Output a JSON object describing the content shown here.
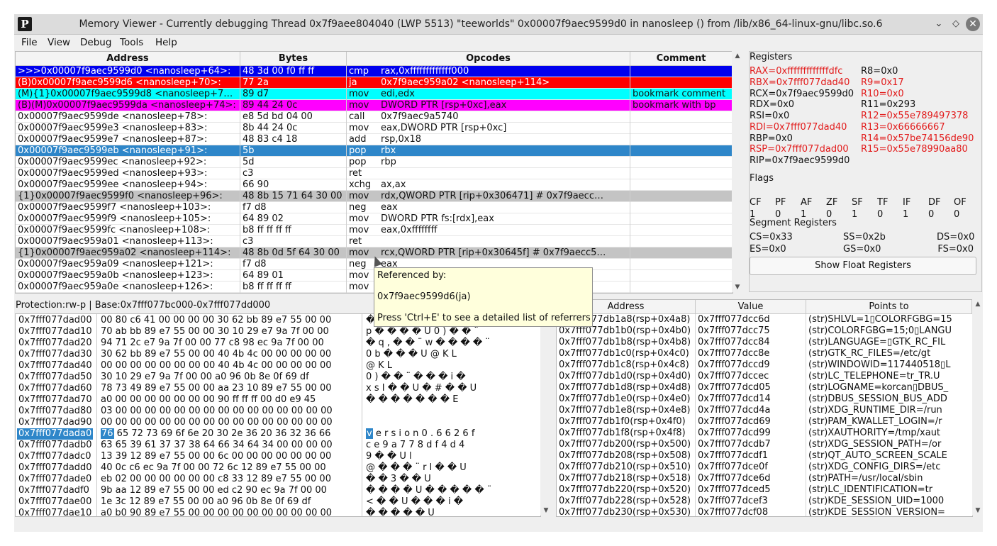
{
  "window": {
    "title": "Memory Viewer - Currently debugging Thread 0x7f9aee804040 (LWP 5513) \"teeworlds\" 0x00007f9aec9599d0 in nanosleep () from /lib/x86_64-linux-gnu/libc.so.6",
    "app_icon": "P",
    "controls": [
      "chevron-down-icon",
      "diamond-icon",
      "close-icon"
    ]
  },
  "menu": [
    {
      "label": "File"
    },
    {
      "label": "View"
    },
    {
      "label": "Debug"
    },
    {
      "label": "Tools"
    },
    {
      "label": "Help"
    }
  ],
  "disasm": {
    "headers": [
      "Address",
      "Bytes",
      "Opcodes",
      "Comment"
    ],
    "rows": [
      {
        "addr": ">>>0x00007f9aec9599d0 <nanosleep+64>:",
        "bytes": "48 3d 00 f0 ff ff",
        "op": "cmp",
        "args": "rax,0xfffffffffffff000",
        "comment": "",
        "bg": "#0000ee",
        "fg": "#ffffff"
      },
      {
        "addr": "(B)0x00007f9aec9599d6 <nanosleep+70>:",
        "bytes": "77 2a",
        "op": "ja",
        "args": "0x7f9aec959a02 <nanosleep+114>",
        "comment": "",
        "bg": "#ff0000",
        "fg": "#ffffff"
      },
      {
        "addr": "(M){1}0x00007f9aec9599d8 <nanosleep+7…",
        "bytes": "89 d7",
        "op": "mov",
        "args": "edi,edx",
        "comment": "bookmark comment",
        "bg": "#00ffff",
        "fg": "#111111"
      },
      {
        "addr": "(B)(M)0x00007f9aec9599da <nanosleep+74>:",
        "bytes": "89 44 24 0c",
        "op": "mov",
        "args": "DWORD PTR [rsp+0xc],eax",
        "comment": "bookmark with bp",
        "bg": "#ff00ff",
        "fg": "#111111"
      },
      {
        "addr": "0x00007f9aec9599de <nanosleep+78>:",
        "bytes": "e8 5d bd 04 00",
        "op": "call",
        "args": "0x7f9aec9a5740",
        "comment": "",
        "bg": "#ffffff",
        "fg": "#111111"
      },
      {
        "addr": "0x00007f9aec9599e3 <nanosleep+83>:",
        "bytes": "8b 44 24 0c",
        "op": "mov",
        "args": "eax,DWORD PTR [rsp+0xc]",
        "comment": "",
        "bg": "#ffffff",
        "fg": "#111111"
      },
      {
        "addr": "0x00007f9aec9599e7 <nanosleep+87>:",
        "bytes": "48 83 c4 18",
        "op": "add",
        "args": "rsp,0x18",
        "comment": "",
        "bg": "#ffffff",
        "fg": "#111111"
      },
      {
        "addr": "0x00007f9aec9599eb <nanosleep+91>:",
        "bytes": "5b",
        "op": "pop",
        "args": "rbx",
        "comment": "",
        "bg": "#2e86c9",
        "fg": "#ffffff"
      },
      {
        "addr": "0x00007f9aec9599ec <nanosleep+92>:",
        "bytes": "5d",
        "op": "pop",
        "args": "rbp",
        "comment": "",
        "bg": "#ffffff",
        "fg": "#111111"
      },
      {
        "addr": "0x00007f9aec9599ed <nanosleep+93>:",
        "bytes": "c3",
        "op": "ret",
        "args": "",
        "comment": "",
        "bg": "#ffffff",
        "fg": "#111111"
      },
      {
        "addr": "0x00007f9aec9599ee <nanosleep+94>:",
        "bytes": "66 90",
        "op": "xchg",
        "args": "ax,ax",
        "comment": "",
        "bg": "#ffffff",
        "fg": "#111111"
      },
      {
        "addr": "{1}0x00007f9aec9599f0 <nanosleep+96>:",
        "bytes": "48 8b 15 71 64 30 00",
        "op": "mov",
        "args": "rdx,QWORD PTR [rip+0x306471]        # 0x7f9aecc…",
        "comment": "",
        "bg": "#c4c4c4",
        "fg": "#111111"
      },
      {
        "addr": "0x00007f9aec9599f7 <nanosleep+103>:",
        "bytes": "f7 d8",
        "op": "neg",
        "args": "eax",
        "comment": "",
        "bg": "#ffffff",
        "fg": "#111111"
      },
      {
        "addr": "0x00007f9aec9599f9 <nanosleep+105>:",
        "bytes": "64 89 02",
        "op": "mov",
        "args": "DWORD PTR fs:[rdx],eax",
        "comment": "",
        "bg": "#ffffff",
        "fg": "#111111"
      },
      {
        "addr": "0x00007f9aec9599fc <nanosleep+108>:",
        "bytes": "b8 ff ff ff ff",
        "op": "mov",
        "args": "eax,0xffffffff",
        "comment": "",
        "bg": "#ffffff",
        "fg": "#111111"
      },
      {
        "addr": "0x00007f9aec959a01 <nanosleep+113>:",
        "bytes": "c3",
        "op": "ret",
        "args": "",
        "comment": "",
        "bg": "#ffffff",
        "fg": "#111111"
      },
      {
        "addr": "{1}0x00007f9aec959a02 <nanosleep+114>:",
        "bytes": "48 8b 0d 5f 64 30 00",
        "op": "mov",
        "args": "rcx,QWORD PTR [rip+0x30645f]        # 0x7f9aecc5…",
        "comment": "",
        "bg": "#c4c4c4",
        "fg": "#111111"
      },
      {
        "addr": "0x00007f9aec959a09 <nanosleep+121>:",
        "bytes": "f7 d8",
        "op": "neg",
        "args": "eax",
        "comment": "",
        "bg": "#ffffff",
        "fg": "#111111"
      },
      {
        "addr": "0x00007f9aec959a0b <nanosleep+123>:",
        "bytes": "64 89 01",
        "op": "mov",
        "args": "",
        "comment": "",
        "bg": "#ffffff",
        "fg": "#111111"
      },
      {
        "addr": "0x00007f9aec959a0e <nanosleep+126>:",
        "bytes": "b8 ff ff ff ff",
        "op": "mov",
        "args": "",
        "comment": "",
        "bg": "#ffffff",
        "fg": "#111111"
      }
    ]
  },
  "registers": {
    "title": "Registers",
    "left": [
      {
        "text": "RAX=0xfffffffffffffdfc",
        "changed": true
      },
      {
        "text": "RBX=0x7fff077dad40",
        "changed": true
      },
      {
        "text": "RCX=0x7f9aec9599d0",
        "changed": false
      },
      {
        "text": "RDX=0x0",
        "changed": false
      },
      {
        "text": "RSI=0x0",
        "changed": false
      },
      {
        "text": "RDI=0x7fff077dad40",
        "changed": true
      },
      {
        "text": "RBP=0x0",
        "changed": false
      },
      {
        "text": "RSP=0x7fff077dad00",
        "changed": true
      },
      {
        "text": "RIP=0x7f9aec9599d0",
        "changed": false
      }
    ],
    "right": [
      {
        "text": "R8=0x0",
        "changed": false
      },
      {
        "text": "R9=0x17",
        "changed": true
      },
      {
        "text": "R10=0x0",
        "changed": true
      },
      {
        "text": "R11=0x293",
        "changed": false
      },
      {
        "text": "R12=0x55e789497378",
        "changed": true
      },
      {
        "text": "R13=0x66666667",
        "changed": true
      },
      {
        "text": "R14=0x57be74156de90",
        "changed": true
      },
      {
        "text": "R15=0x55e78990aa80",
        "changed": true
      }
    ],
    "flags_title": "Flags",
    "flags": [
      {
        "name": "CF",
        "value": "1"
      },
      {
        "name": "PF",
        "value": "0"
      },
      {
        "name": "AF",
        "value": "1"
      },
      {
        "name": "ZF",
        "value": "0"
      },
      {
        "name": "SF",
        "value": "1"
      },
      {
        "name": "TF",
        "value": "0"
      },
      {
        "name": "IF",
        "value": "1"
      },
      {
        "name": "DF",
        "value": "0"
      },
      {
        "name": "OF",
        "value": "0"
      }
    ],
    "segment_title": "Segment Registers",
    "segments": [
      "CS=0x33",
      "SS=0x2b",
      "DS=0x0",
      "ES=0x0",
      "GS=0x0",
      "FS=0x0"
    ],
    "show_float": "Show Float Registers"
  },
  "hex": {
    "info": "Protection:rw-p | Base:0x7fff077bc000-0x7fff077dd000",
    "rows": [
      {
        "addr": "0x7fff077dad00",
        "bytes": "00 80 c6 41 00 00 00 00 30 62 bb 89 e7 55 00 00",
        "ascii": "� � A         0 b � � � U    "
      },
      {
        "addr": "0x7fff077dad10",
        "bytes": "70 ab bb 89 e7 55 00 00 30 10 29 e7 9a 7f 00 00",
        "ascii": "p � � � � U     0 ) � � ¨  "
      },
      {
        "addr": "0x7fff077dad20",
        "bytes": "94 71 2c e7 9a 7f 00 00 77 c8 98 ec 9a 7f 00 00",
        "ascii": "� q , � � ¨     w � � � � ¨  "
      },
      {
        "addr": "0x7fff077dad30",
        "bytes": "30 62 bb 89 e7 55 00 00 40 4b 4c 00 00 00 00 00",
        "ascii": "0 b � � � U     @ K L        "
      },
      {
        "addr": "0x7fff077dad40",
        "bytes": "00 00 00 00 00 00 00 00 40 4b 4c 00 00 00 00 00",
        "ascii": "                @ K L        "
      },
      {
        "addr": "0x7fff077dad50",
        "bytes": "30 10 29 e7 9a 7f 00 00 a0 96 0b 8e 0f 69 df",
        "ascii": "0   ) � � ¨     � � � i �"
      },
      {
        "addr": "0x7fff077dad60",
        "bytes": "78 73 49 89 e7 55 00 00 aa 23 10 89 e7 55 00 00",
        "ascii": "x s I � � U     � # � � U    "
      },
      {
        "addr": "0x7fff077dad70",
        "bytes": "a0 00 00 00 00 00 00 00 90 ff ff ff 00 d0 e9 45",
        "ascii": "�               � � � �   � � E"
      },
      {
        "addr": "0x7fff077dad80",
        "bytes": "03 00 00 00 00 00 00 00 00 00 00 00 00 00 00 00",
        "ascii": "                             "
      },
      {
        "addr": "0x7fff077dad90",
        "bytes": "00 00 00 00 00 00 00 00 00 00 00 00 00 00 00 00",
        "ascii": "                             "
      },
      {
        "addr": "0x7fff077dada0",
        "bytes": "76 65 72 73 69 6f 6e 20 30 2e 36 20 36 32 36 66",
        "ascii": "v e r s i o n   0 . 6   6 2 6 f"
      },
      {
        "addr": "0x7fff077dadb0",
        "bytes": "63 65 39 61 37 37 38 64 66 34 64 34 00 00 00 00",
        "ascii": "c e 9 a 7 7 8 d f 4 d 4      "
      },
      {
        "addr": "0x7fff077dadc0",
        "bytes": "13 39 12 89 e7 55 00 00 6c 00 00 00 00 00 00 00",
        "ascii": "  9   � � U     l            "
      },
      {
        "addr": "0x7fff077dadd0",
        "bytes": "40 0c c6 ec 9a 7f 00 00 72 6c 12 89 e7 55 00 00",
        "ascii": "@   � � � ¨     r l   � � U    "
      },
      {
        "addr": "0x7fff077dade0",
        "bytes": "eb 02 00 00 00 00 00 00 c8 33 12 89 e7 55 00 00",
        "ascii": "�               � 3   � � U    "
      },
      {
        "addr": "0x7fff077dadf0",
        "bytes": "9b aa 12 89 e7 55 00 00 ed c2 90 ec 9a 7f 00 00",
        "ascii": "� �   � � U     � � � � � ¨  "
      },
      {
        "addr": "0x7fff077dae00",
        "bytes": "1e 3c 12 89 e7 55 00 00 a0 96 0b 8e 0f 69 df",
        "ascii": "  <   � � U     � � � i �"
      },
      {
        "addr": "0x7fff077dae10",
        "bytes": "a0 b0 90 89 e7 55 00 00 00 00 00 00 00 00 00 00",
        "ascii": "� � � � � U                  "
      }
    ],
    "selected_addr": "0x7fff077dada0",
    "selected_byte": "76"
  },
  "stack": {
    "headers": [
      "Address",
      "Value",
      "Points to"
    ],
    "rows": [
      {
        "addr": "0x7fff077db1a8(rsp+0x4a8)",
        "value": "0x7fff077dcc6d",
        "points": "(str)SHLVL=1▯COLORFGBG=15"
      },
      {
        "addr": "0x7fff077db1b0(rsp+0x4b0)",
        "value": "0x7fff077dcc75",
        "points": "(str)COLORFGBG=15;0▯LANGU"
      },
      {
        "addr": "0x7fff077db1b8(rsp+0x4b8)",
        "value": "0x7fff077dcc84",
        "points": "(str)LANGUAGE=▯GTK_RC_FIL"
      },
      {
        "addr": "0x7fff077db1c0(rsp+0x4c0)",
        "value": "0x7fff077dcc8e",
        "points": "(str)GTK_RC_FILES=/etc/gt"
      },
      {
        "addr": "0x7fff077db1c8(rsp+0x4c8)",
        "value": "0x7fff077dccd9",
        "points": "(str)WINDOWID=117440518▯L"
      },
      {
        "addr": "0x7fff077db1d0(rsp+0x4d0)",
        "value": "0x7fff077dccec",
        "points": "(str)LC_TELEPHONE=tr_TR.U"
      },
      {
        "addr": "0x7fff077db1d8(rsp+0x4d8)",
        "value": "0x7fff077dcd05",
        "points": "(str)LOGNAME=korcan▯DBUS_"
      },
      {
        "addr": "0x7fff077db1e0(rsp+0x4e0)",
        "value": "0x7fff077dcd14",
        "points": "(str)DBUS_SESSION_BUS_ADD"
      },
      {
        "addr": "0x7fff077db1e8(rsp+0x4e8)",
        "value": "0x7fff077dcd4a",
        "points": "(str)XDG_RUNTIME_DIR=/run"
      },
      {
        "addr": "0x7fff077db1f0(rsp+0x4f0)",
        "value": "0x7fff077dcd69",
        "points": "(str)PAM_KWALLET_LOGIN=/r"
      },
      {
        "addr": "0x7fff077db1f8(rsp+0x4f8)",
        "value": "0x7fff077dcd99",
        "points": "(str)XAUTHORITY=/tmp/xaut"
      },
      {
        "addr": "0x7fff077db200(rsp+0x500)",
        "value": "0x7fff077dcdb7",
        "points": "(str)XDG_SESSION_PATH=/or"
      },
      {
        "addr": "0x7fff077db208(rsp+0x508)",
        "value": "0x7fff077dcdf1",
        "points": "(str)QT_AUTO_SCREEN_SCALE"
      },
      {
        "addr": "0x7fff077db210(rsp+0x510)",
        "value": "0x7fff077dce0f",
        "points": "(str)XDG_CONFIG_DIRS=/etc"
      },
      {
        "addr": "0x7fff077db218(rsp+0x518)",
        "value": "0x7fff077dce6d",
        "points": "(str)PATH=/usr/local/sbin"
      },
      {
        "addr": "0x7fff077db220(rsp+0x520)",
        "value": "0x7fff077dced5",
        "points": "(str)LC_IDENTIFICATION=tr"
      },
      {
        "addr": "0x7fff077db228(rsp+0x528)",
        "value": "0x7fff077dcef3",
        "points": "(str)KDE_SESSION_UID=1000"
      },
      {
        "addr": "0x7fff077db230(rsp+0x530)",
        "value": "0x7fff077dcf08",
        "points": "(str)KDE_SESSION_VERSION="
      }
    ]
  },
  "tooltip": {
    "line1": "Referenced by:",
    "line2": "0x7f9aec9599d6(ja)",
    "line3": "Press 'Ctrl+E' to see a detailed list of referrers"
  }
}
